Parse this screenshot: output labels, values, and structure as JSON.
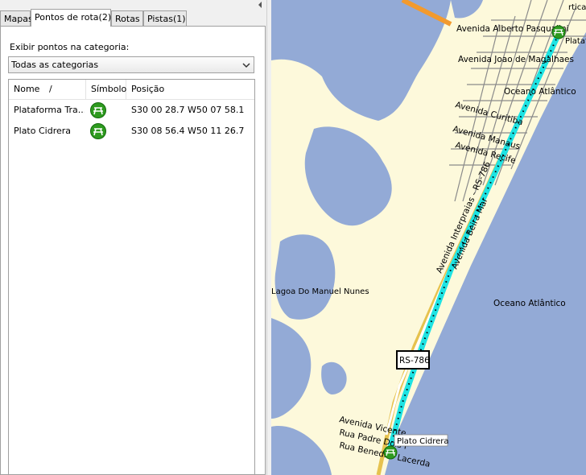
{
  "tabs": [
    {
      "label": "Mapas"
    },
    {
      "label": "Pontos de rota(2)",
      "active": true
    },
    {
      "label": "Rotas"
    },
    {
      "label": "Pistas(1)"
    }
  ],
  "filter": {
    "label": "Exibir pontos na categoria:",
    "selected": "Todas as categorias"
  },
  "table": {
    "headers": {
      "name": "Nome",
      "sort": "/",
      "symbol": "Símbolo",
      "position": "Posição"
    },
    "rows": [
      {
        "name": "Plataforma Tra...",
        "symbol": "picnic-icon",
        "position": "S30 00 28.7 W50 07 58.1"
      },
      {
        "name": "Plato Cidrera",
        "symbol": "picnic-icon",
        "position": "S30 08 56.4 W50 11 26.7"
      }
    ]
  },
  "map": {
    "labels": {
      "avenida_alberto": "Avenida Alberto Pasqualini",
      "avenida_joao": "Avenida Joao de Magalhaes",
      "oceano_top": "Oceano Atlântico",
      "avenida_curitiba": "Avenida Curitiba",
      "avenida_manaus": "Avenida Manaus",
      "avenida_recife": "Avenida Recife",
      "avenida_interpraias": "Avenida Interpraias - RS-786",
      "avenida_beira_mar": "Avenida Beira Mar",
      "lagoa": "Lagoa Do Manuel Nunes",
      "oceano": "Oceano Atlântico",
      "shield": "RS-786",
      "avenida_vicente": "Avenida Vicente",
      "rua_padre": "Rua Padre Dois F",
      "rua_benedito": "Rua Benedito Lacerda",
      "plato_tag": "Plato Cidrera",
      "plat_tag": "Plataf",
      "corner_text": "rtica"
    },
    "colors": {
      "water": "#93aad6",
      "land": "#fdf9db",
      "track": "#1ee3e3",
      "major_road": "#f29a2e"
    }
  }
}
